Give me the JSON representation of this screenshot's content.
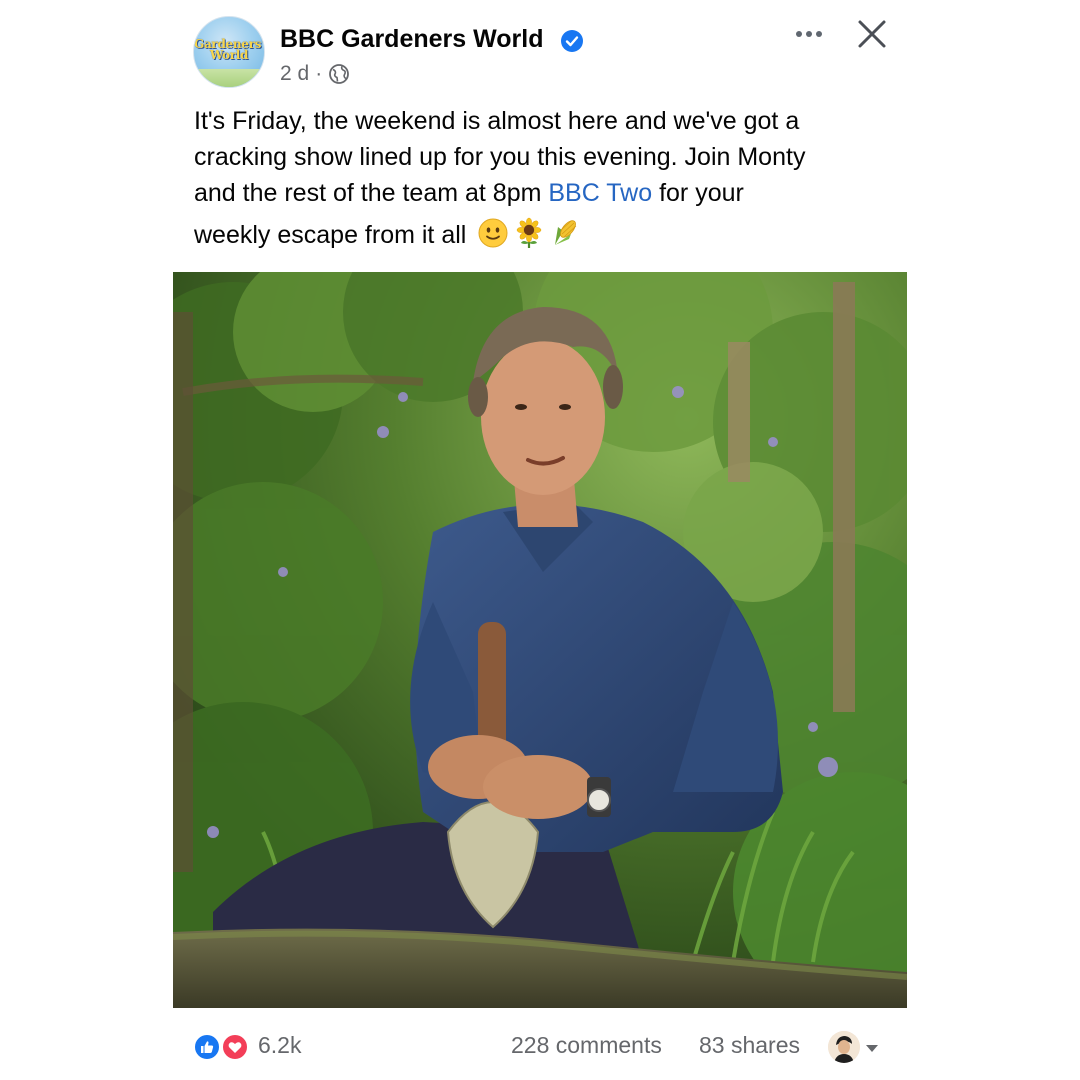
{
  "post": {
    "page_name": "BBC Gardeners World",
    "avatar_logo_line1": "Gardeners'",
    "avatar_logo_line2": "World",
    "time": "2 d",
    "separator": "·",
    "text_lines": [
      "It's Friday, the weekend is almost here and we've got a",
      "cracking show lined up for you this evening. Join Monty",
      "and the rest of the team at 8pm "
    ],
    "link_text": "BBC Two",
    "line3_suffix": " for your",
    "line4": "weekly escape from it all",
    "emojis": [
      "slightly-smiling-face",
      "sunflower",
      "ear-of-corn"
    ]
  },
  "footer": {
    "reaction_count": "6.2k",
    "comments": "228 comments",
    "shares": "83 shares"
  },
  "icons": {
    "verified": "verified-badge-icon",
    "audience": "globe-icon",
    "more": "more-icon",
    "close": "close-icon",
    "like": "like-icon",
    "love": "love-icon"
  },
  "colors": {
    "brand_blue": "#1877f2",
    "link_blue": "#2666c2",
    "secondary_text": "#65676b",
    "love_red": "#f33e58"
  }
}
